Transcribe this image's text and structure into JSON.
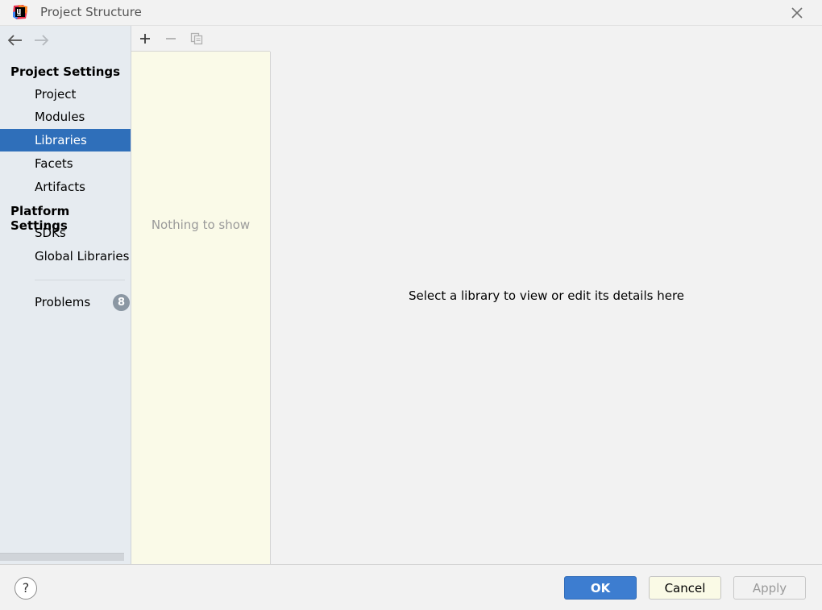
{
  "window": {
    "title": "Project Structure",
    "app_icon": "intellij-idea-logo-icon",
    "close_icon": "close-icon"
  },
  "navigation": {
    "back_icon": "arrow-left-icon",
    "forward_icon": "arrow-right-icon"
  },
  "sidebar": {
    "project_settings_header": "Project Settings",
    "project_settings_items": [
      {
        "label": "Project"
      },
      {
        "label": "Modules"
      },
      {
        "label": "Libraries",
        "selected": true
      },
      {
        "label": "Facets"
      },
      {
        "label": "Artifacts"
      }
    ],
    "platform_settings_header": "Platform Settings",
    "platform_settings_items": [
      {
        "label": "SDKs"
      },
      {
        "label": "Global Libraries"
      }
    ],
    "problems": {
      "label": "Problems",
      "count": "8"
    }
  },
  "list_toolbar": {
    "add_icon": "plus-icon",
    "remove_icon": "minus-icon",
    "copy_icon": "copy-icon"
  },
  "list_panel": {
    "empty_text": "Nothing to show"
  },
  "details": {
    "placeholder": "Select a library to view or edit its details here"
  },
  "footer": {
    "help_label": "?",
    "ok_label": "OK",
    "cancel_label": "Cancel",
    "apply_label": "Apply"
  },
  "colors": {
    "selection": "#2f6fba",
    "sidebar_bg": "#e6ebf0",
    "list_bg": "#fafae8",
    "ok_button": "#3d7dd0"
  }
}
